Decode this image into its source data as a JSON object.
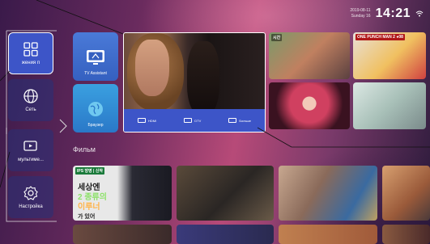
{
  "status": {
    "date_line1": "2019-08-11",
    "date_line2": "Sunday 16",
    "time": "14:21"
  },
  "sidebar": {
    "items": [
      {
        "label": "жения   п",
        "icon": "grid-icon",
        "active": true
      },
      {
        "label": "Сеть",
        "icon": "globe-icon",
        "active": false
      },
      {
        "label": "мультиме...",
        "icon": "media-icon",
        "active": false
      },
      {
        "label": "Настройка",
        "icon": "gear-icon",
        "active": false
      }
    ]
  },
  "apps": {
    "tv_assistant": "TV Assistant",
    "browser": "Браузер"
  },
  "sources": [
    {
      "label": "HDMI"
    },
    {
      "label": "DTV"
    },
    {
      "label": "Больше"
    }
  ],
  "top_row": [
    {
      "label": "시간"
    },
    {
      "label": "ONE PUNCH MAN 2  ●08"
    }
  ],
  "section": {
    "title": "Фильм"
  },
  "movies": [
    {
      "badge": "IPS 방영 | 신작",
      "line1": "세상엔",
      "line2": "2 종류의",
      "line3": "이루너",
      "line4": "가 있어"
    },
    {
      "badge": ""
    },
    {
      "badge": ""
    },
    {
      "badge": ""
    }
  ],
  "colors": {
    "accent": "#3d55c8",
    "background": "#6a2b5e"
  }
}
